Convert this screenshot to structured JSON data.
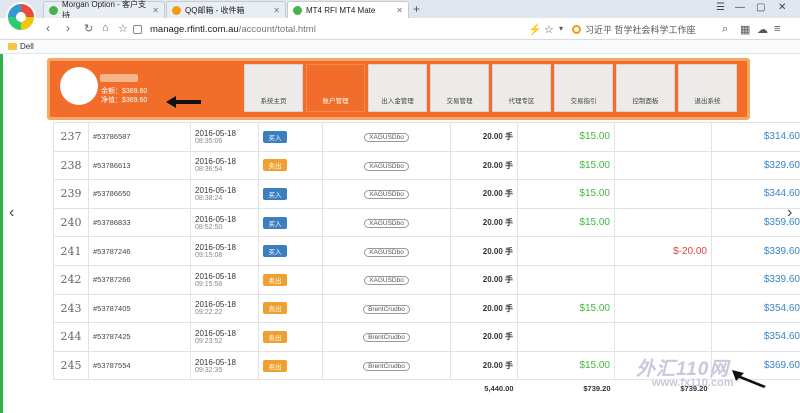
{
  "tabs": [
    {
      "label": "Morgan Option - 客户支持",
      "icon_color": "#4caf50"
    },
    {
      "label": "QQ邮箱 - 收件箱",
      "icon_color": "#f39c12"
    },
    {
      "label": "MT4 RFI MT4 Mate",
      "icon_color": "#4caf50"
    }
  ],
  "address": {
    "host": "manage.rfintl.com.au",
    "path": "/account/total.html"
  },
  "search": {
    "text": "习近平 哲学社会科学工作座"
  },
  "bookmarks": [
    {
      "label": "Dell"
    }
  ],
  "account": {
    "balance_line": "余额：$369.60",
    "equity_line": "净值：$369.60"
  },
  "menu": [
    {
      "label": "系统主页"
    },
    {
      "label": "账户管理"
    },
    {
      "label": "出入金管理"
    },
    {
      "label": "交易管理"
    },
    {
      "label": "代理专区"
    },
    {
      "label": "交易指引"
    },
    {
      "label": "控制面板"
    },
    {
      "label": "退出系统"
    }
  ],
  "trades": [
    {
      "idx": "237",
      "order": "#53786587",
      "date": "2016-05-18",
      "time": "08:35:06",
      "side": "买入",
      "symbol": "XAGUSDbo",
      "lots": "20.00 手",
      "profit": "$15.00",
      "loss": "",
      "balance": "$314.60"
    },
    {
      "idx": "238",
      "order": "#53786613",
      "date": "2016-05-18",
      "time": "08:36:54",
      "side": "卖出",
      "symbol": "XAGUSDbo",
      "lots": "20.00 手",
      "profit": "$15.00",
      "loss": "",
      "balance": "$329.60"
    },
    {
      "idx": "239",
      "order": "#53786650",
      "date": "2016-05-18",
      "time": "08:38:24",
      "side": "买入",
      "symbol": "XAGUSDbo",
      "lots": "20.00 手",
      "profit": "$15.00",
      "loss": "",
      "balance": "$344.60"
    },
    {
      "idx": "240",
      "order": "#53786833",
      "date": "2016-05-18",
      "time": "08:52:50",
      "side": "买入",
      "symbol": "XAGUSDbo",
      "lots": "20.00 手",
      "profit": "$15.00",
      "loss": "",
      "balance": "$359.60"
    },
    {
      "idx": "241",
      "order": "#53787246",
      "date": "2016-05-18",
      "time": "09:15:08",
      "side": "买入",
      "symbol": "XAGUSDbo",
      "lots": "20.00 手",
      "profit": "",
      "loss": "$-20.00",
      "balance": "$339.60"
    },
    {
      "idx": "242",
      "order": "#53787266",
      "date": "2016-05-18",
      "time": "09:15:58",
      "side": "卖出",
      "symbol": "XAGUSDbo",
      "lots": "20.00 手",
      "profit": "",
      "loss": "",
      "balance": "$339.60"
    },
    {
      "idx": "243",
      "order": "#53787405",
      "date": "2016-05-18",
      "time": "09:22:22",
      "side": "卖出",
      "symbol": "BrentCrudbo",
      "lots": "20.00 手",
      "profit": "$15.00",
      "loss": "",
      "balance": "$354.60"
    },
    {
      "idx": "244",
      "order": "#53787425",
      "date": "2016-05-18",
      "time": "09:23:52",
      "side": "卖出",
      "symbol": "BrentCrudbo",
      "lots": "20.00 手",
      "profit": "",
      "loss": "",
      "balance": "$354.60"
    },
    {
      "idx": "245",
      "order": "#53787554",
      "date": "2016-05-18",
      "time": "09:32:35",
      "side": "卖出",
      "symbol": "BrentCrudbo",
      "lots": "20.00 手",
      "profit": "$15.00",
      "loss": "",
      "balance": "$369.60"
    }
  ],
  "totals": {
    "lots": "5,440.00",
    "profit": "$739.20",
    "loss": "$739.20"
  },
  "watermark": {
    "brand": "外汇110网",
    "url": "www.fx110.com"
  },
  "colors": {
    "header_orange": "#f26c2a",
    "buy": "#3c7fbf",
    "sell": "#f0a030",
    "profit": "#3fb83f",
    "loss": "#e0463c",
    "balance": "#3a85c8"
  }
}
